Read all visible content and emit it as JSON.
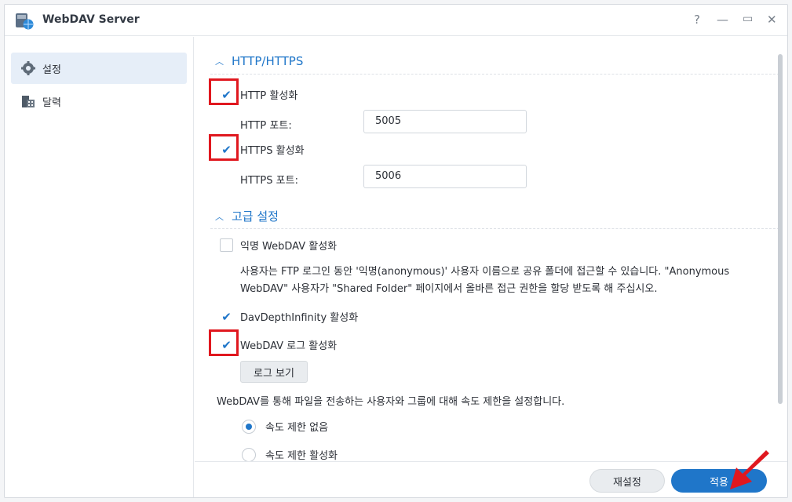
{
  "window": {
    "title": "WebDAV Server",
    "controls": {
      "help": "?",
      "minimize": "—",
      "maximize": "▭",
      "close": "✕"
    }
  },
  "sidebar": {
    "items": [
      {
        "label": "설정",
        "icon": "gear-icon",
        "active": true
      },
      {
        "label": "달력",
        "icon": "calendar-icon",
        "active": false
      }
    ]
  },
  "http_section": {
    "title": "HTTP/HTTPS",
    "http_enable_label": "HTTP 활성화",
    "http_enabled": true,
    "http_port_label": "HTTP 포트:",
    "http_port_value": "5005",
    "https_enable_label": "HTTPS 활성화",
    "https_enabled": true,
    "https_port_label": "HTTPS 포트:",
    "https_port_value": "5006"
  },
  "advanced_section": {
    "title": "고급 설정",
    "anonymous_label": "익명 WebDAV 활성화",
    "anonymous_enabled": false,
    "anonymous_desc_line1": "사용자는 FTP 로그인 동안 '익명(anonymous)' 사용자 이름으로 공유 폴더에 접근할 수 있습니다. \"Anonymous",
    "anonymous_desc_line2": "WebDAV\" 사용자가 \"Shared Folder\" 페이지에서 올바른 접근 권한을 할당 받도록 해 주십시오.",
    "davdepth_label": "DavDepthInfinity 활성화",
    "davdepth_enabled": true,
    "log_label": "WebDAV 로그 활성화",
    "log_enabled": true,
    "view_log_button": "로그 보기",
    "speed_desc": "WebDAV를 통해 파일을 전송하는 사용자와 그룹에 대해 속도 제한을 설정합니다.",
    "speed_options": [
      {
        "label": "속도 제한 없음",
        "selected": true
      },
      {
        "label": "속도 제한 활성화",
        "selected": false
      }
    ]
  },
  "footer": {
    "reset_label": "재설정",
    "apply_label": "적용"
  },
  "colors": {
    "accent": "#1f76c9",
    "highlight_red": "#e0181f"
  }
}
